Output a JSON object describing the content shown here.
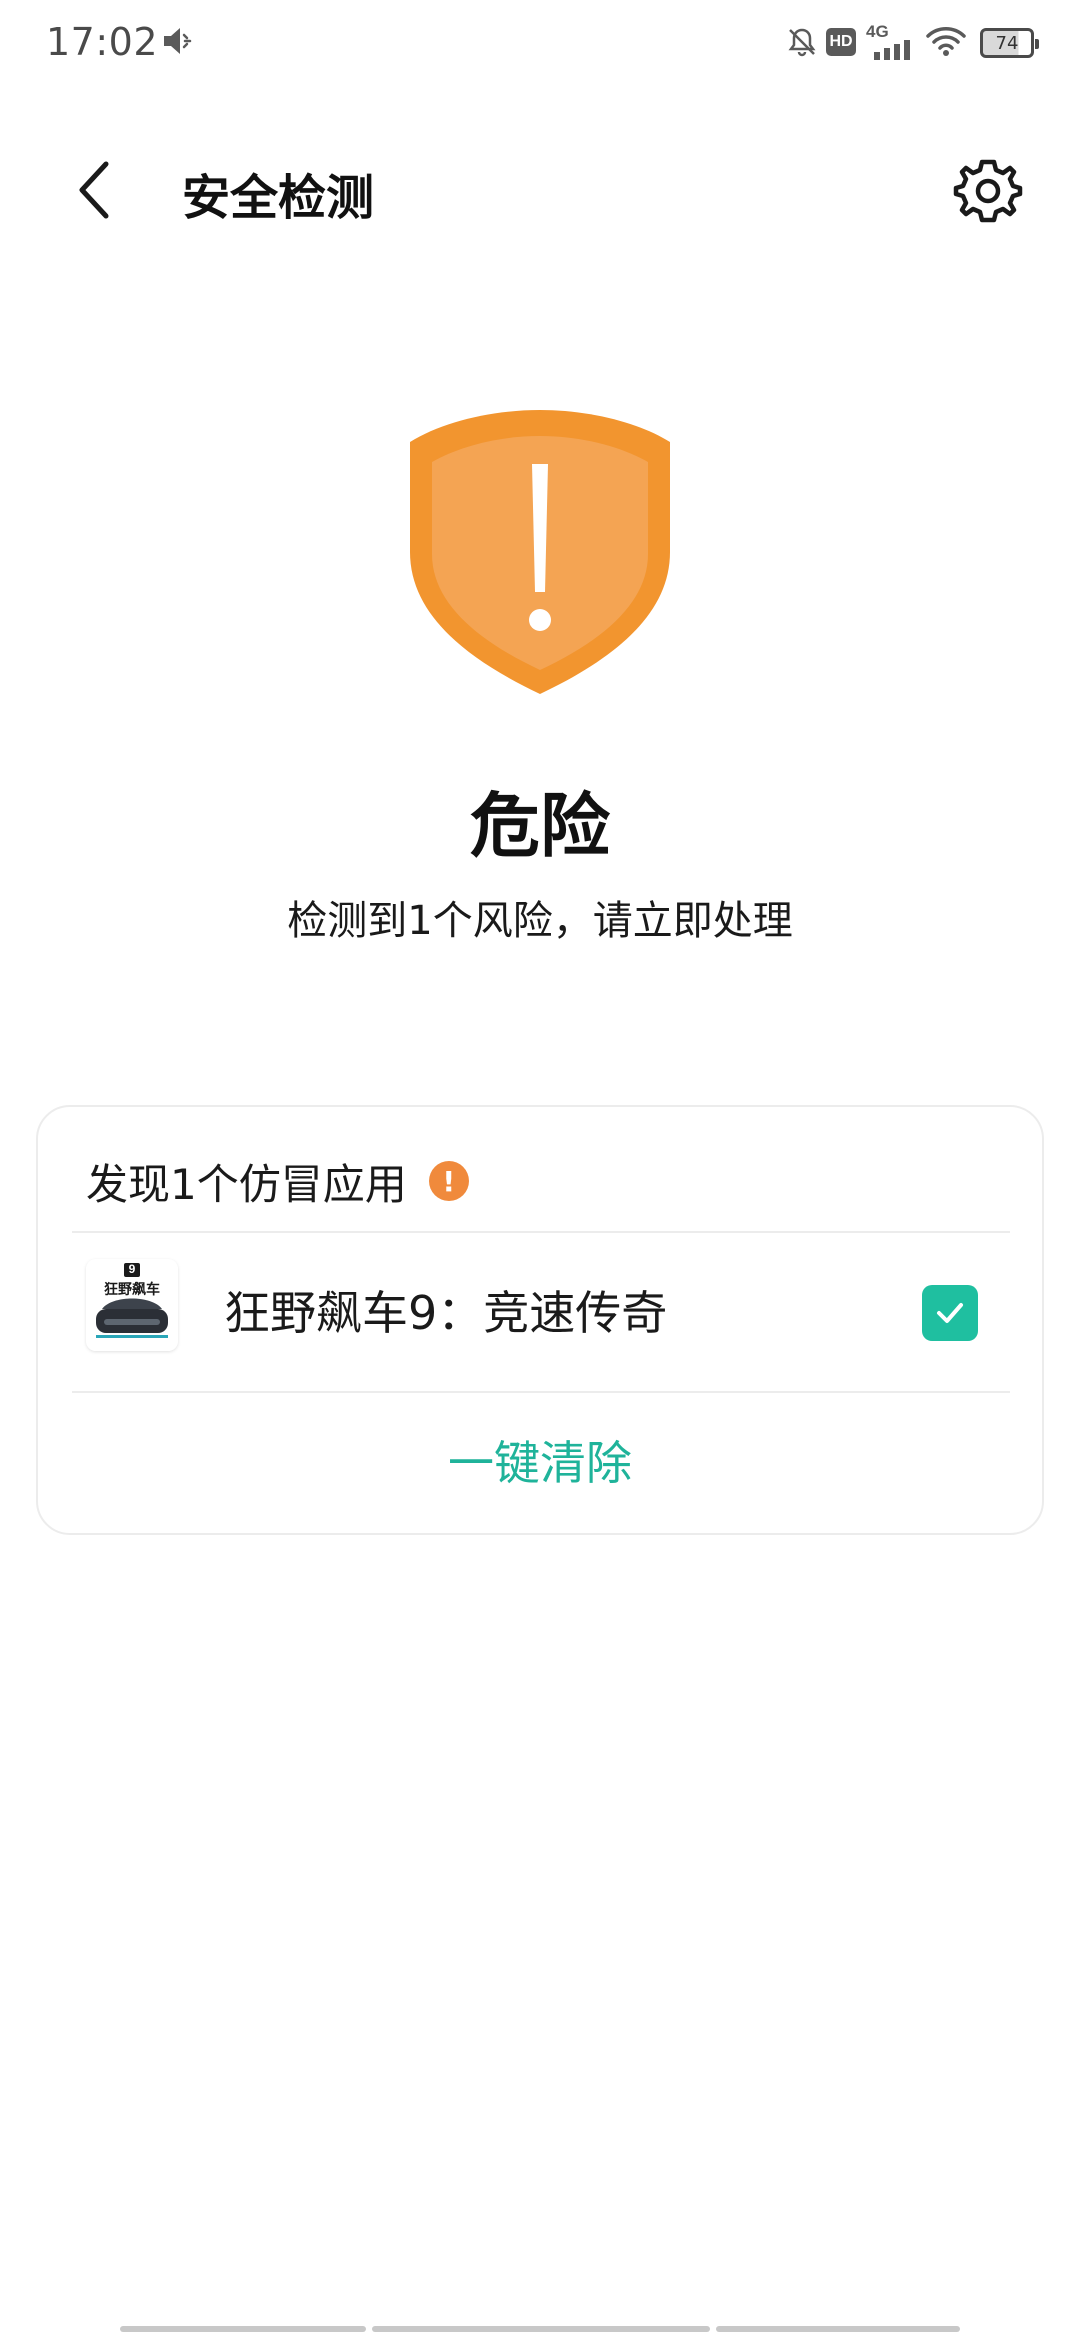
{
  "status_bar": {
    "time": "17:02",
    "battery": "74",
    "network": "4G",
    "hd_label": "HD",
    "icons": [
      "volume-icon",
      "notification-off-icon",
      "hd-icon",
      "signal-icon",
      "wifi-icon",
      "battery-icon"
    ]
  },
  "header": {
    "title": "安全检测",
    "back_icon": "back-arrow-icon",
    "settings_icon": "gear-icon"
  },
  "hero": {
    "status_title": "危险",
    "description": "检测到1个风险，请立即处理",
    "shield_icon": "warning-shield-icon",
    "shield_color": "#f2952f"
  },
  "card": {
    "title": "发现1个仿冒应用",
    "warning_badge": "!",
    "apps": [
      {
        "name": "狂野飙车9：竞速传奇",
        "checked": true,
        "icon_badge": "9",
        "icon_text": "狂野飙车"
      }
    ],
    "action_label": "一键清除",
    "accent_color": "#1fb39a"
  }
}
